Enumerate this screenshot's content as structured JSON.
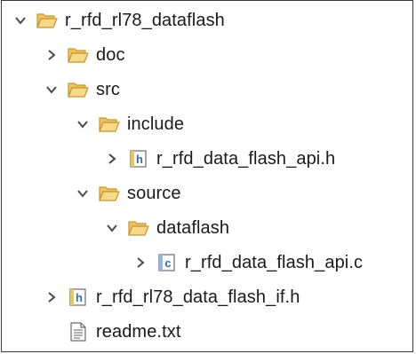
{
  "tree": {
    "rows": [
      {
        "label": "r_rfd_rl78_dataflash",
        "type": "folder",
        "expanded": true,
        "twisty": "chevron-down"
      },
      {
        "label": "doc",
        "type": "folder",
        "expanded": false,
        "twisty": "chevron-right"
      },
      {
        "label": "src",
        "type": "folder",
        "expanded": true,
        "twisty": "chevron-down"
      },
      {
        "label": "include",
        "type": "folder",
        "expanded": true,
        "twisty": "chevron-down"
      },
      {
        "label": "r_rfd_data_flash_api.h",
        "type": "h-file",
        "expanded": false,
        "twisty": "chevron-right"
      },
      {
        "label": "source",
        "type": "folder",
        "expanded": true,
        "twisty": "chevron-down"
      },
      {
        "label": "dataflash",
        "type": "folder",
        "expanded": true,
        "twisty": "chevron-down"
      },
      {
        "label": "r_rfd_data_flash_api.c",
        "type": "c-file",
        "expanded": false,
        "twisty": "chevron-right"
      },
      {
        "label": "r_rfd_rl78_data_flash_if.h",
        "type": "h-file",
        "expanded": false,
        "twisty": "chevron-right"
      },
      {
        "label": "readme.txt",
        "type": "text-file",
        "expanded": false,
        "twisty": "none"
      }
    ],
    "icon_letters": {
      "h_file": "h",
      "c_file": "c"
    }
  },
  "colors": {
    "folder_fill": "#f5d27a",
    "folder_stroke": "#c8952d",
    "twisty": "#4a4a4a",
    "h_badge": "#2f6db3",
    "c_badge": "#2f6db3",
    "text": "#1a1a1a"
  }
}
